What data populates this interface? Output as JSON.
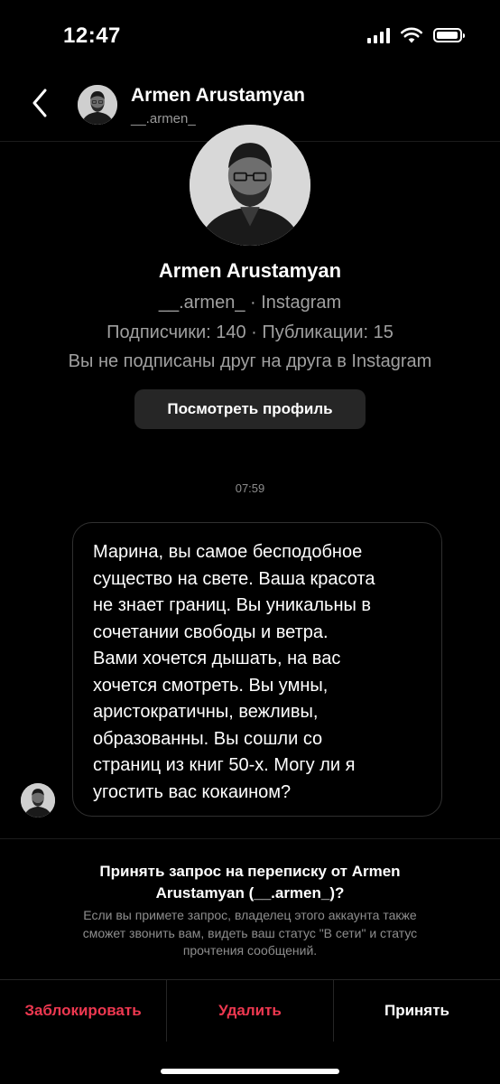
{
  "status_bar": {
    "time": "12:47"
  },
  "header": {
    "name": "Armen Arustamyan",
    "username": "__.armen_"
  },
  "profile": {
    "name": "Armen Arustamyan",
    "handle_line": "__.armen_ · Instagram",
    "stats_line": "Подписчики: 140 · Публикации: 15",
    "follow_status": "Вы не подписаны друг на друга в Instagram",
    "view_profile_label": "Посмотреть профиль"
  },
  "conversation": {
    "timestamp": "07:59",
    "message_text": "Марина, вы самое бесподобное\nсущество на свете. Ваша красота\nне знает границ. Вы уникальны в\nсочетании свободы и ветра.\nВами хочется дышать, на вас\nхочется смотреть. Вы умны,\nаристократичны, вежливы,\nобразованны. Вы сошли со\nстраниц из книг 50-х. Могу ли я\nугостить вас кокаином?"
  },
  "request": {
    "title": "Принять запрос на переписку от Armen\nArustamyan (__.armen_)?",
    "description": "Если вы примете запрос, владелец этого аккаунта также\nсможет звонить вам, видеть ваш статус \"В сети\" и статус\nпрочтения сообщений."
  },
  "actions": {
    "block_label": "Заблокировать",
    "delete_label": "Удалить",
    "accept_label": "Принять"
  },
  "colors": {
    "background": "#000000",
    "destructive": "#ee3850",
    "secondary_text": "#8e8e8e",
    "button_bg": "#262626"
  },
  "icons": {
    "back": "chevron-left-icon",
    "signal": "cellular-signal-icon",
    "wifi": "wifi-icon",
    "battery": "battery-icon"
  }
}
